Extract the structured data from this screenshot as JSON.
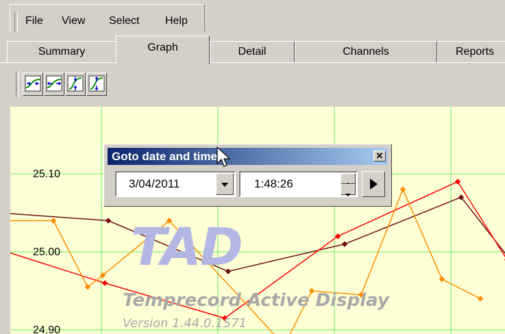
{
  "menu": {
    "items": [
      "File",
      "View",
      "Select",
      "Help"
    ]
  },
  "tabs": [
    {
      "label": "Summary",
      "active": false
    },
    {
      "label": "Graph",
      "active": true
    },
    {
      "label": "Detail",
      "active": false
    },
    {
      "label": "Channels",
      "active": false
    },
    {
      "label": "Reports",
      "active": false
    }
  ],
  "toolbar": {
    "buttons": [
      "zoom-in-time-icon",
      "zoom-out-time-icon",
      "zoom-in-value-icon",
      "zoom-out-value-icon"
    ]
  },
  "chart": {
    "y_ticks": [
      "25.10",
      "25.00",
      "24.90"
    ],
    "watermark": {
      "title": "TAD",
      "subtitle": "Temprecord Active Display",
      "version": "Version 1.44.0.1571"
    },
    "colors": {
      "background": "#ffffd6",
      "grid": "#66ee66",
      "series_red": "#ff0000",
      "series_orange": "#ff8c00",
      "series_brown": "#701010"
    }
  },
  "chart_data": {
    "type": "line",
    "y_tick_labels": [
      "25.10",
      "25.00",
      "24.90"
    ],
    "series": [
      {
        "values": [
          25.05,
          25.04,
          24.975,
          25.01,
          25.07,
          24.995
        ]
      },
      {
        "values": [
          25.0,
          24.96,
          24.915,
          25.02,
          25.09,
          24.99
        ]
      },
      {
        "values": [
          25.04,
          25.04,
          24.955,
          24.97,
          25.04,
          24.88,
          24.95,
          24.945,
          25.08,
          24.965,
          24.94
        ]
      }
    ]
  },
  "dialog": {
    "title": "Goto date and time",
    "date_value": "3/04/2011",
    "time_value": "1:48:26"
  }
}
